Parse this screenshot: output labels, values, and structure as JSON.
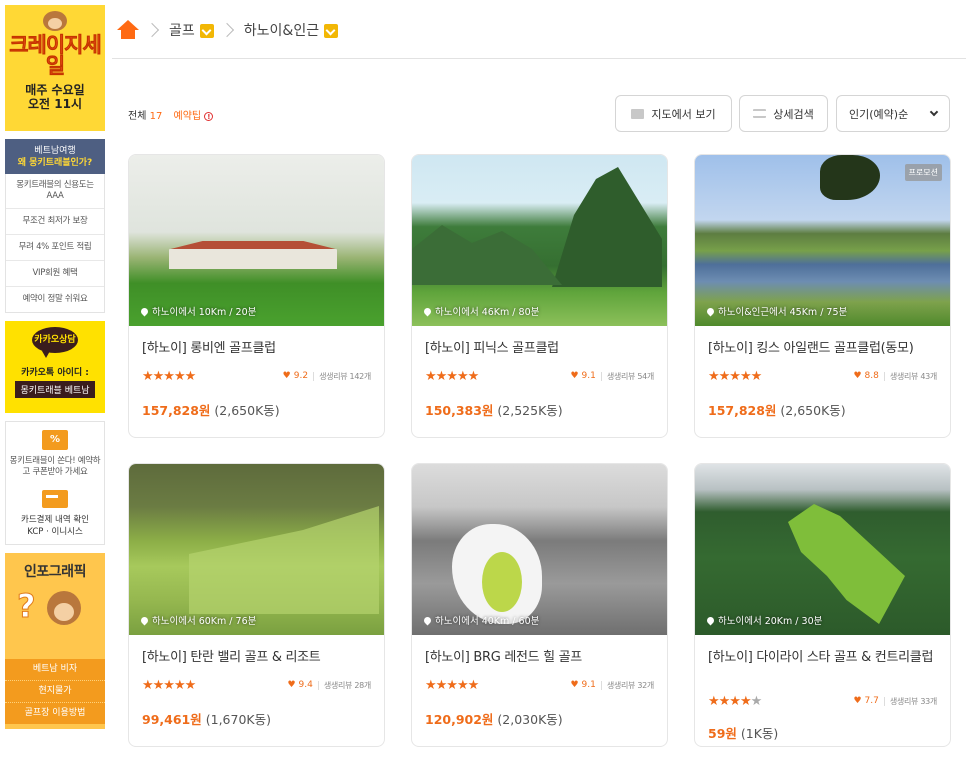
{
  "sidebar": {
    "crazy_title": "크레이지세일",
    "crazy_sub1": "매주 수요일",
    "crazy_sub2": "오전 11시",
    "why_line1": "베트남여행",
    "why_line2": "왜 몽키트래블인가?",
    "trust_items": [
      "몽키트래블의 신용도는 AAA",
      "무조건 최저가 보장",
      "무려 4% 포인트 적립",
      "VIP회원 혜택",
      "예약이 정말 쉬워요"
    ],
    "kakao_bubble": "카카오상담",
    "kakao_id_label": "카카오톡 아이디 :",
    "kakao_id": "몽키트래블 베트남",
    "coupon_icon": "%",
    "coupon_text": "몽키트래블이 쏜다! 예약하고 쿠폰받아 가세요",
    "card_text1": "카드결제 내역 확인",
    "card_text2": "KCP · 이니시스",
    "info_title": "인포그래픽",
    "info_links": [
      "베트남 비자",
      "현지물가",
      "골프장 이용방법"
    ]
  },
  "breadcrumb": {
    "cat1": "골프",
    "cat2": "하노이&인근"
  },
  "toolbar": {
    "total_label": "전체",
    "total_count": "17",
    "tip_label": "예약팁",
    "tip_icon": "!",
    "map_btn": "지도에서 보기",
    "filter_btn": "상세검색",
    "sort_btn": "인기(예약)순"
  },
  "colors": {
    "accent": "#ef6c1a",
    "home": "#ff6a13",
    "dropdown": "#f2b705"
  },
  "cards": [
    {
      "loc": "하노이에서 10Km / 20분",
      "name": "[하노이] 롱비엔 골프클럽",
      "stars": "★★★★★",
      "stars_off": "",
      "score": "9.2",
      "reviews": "생생리뷰 142개",
      "price_won": "157,828원",
      "price_local": "(2,650K동)",
      "promo": ""
    },
    {
      "loc": "하노이에서 46Km / 80분",
      "name": "[하노이] 피닉스 골프클럽",
      "stars": "★★★★★",
      "stars_off": "",
      "score": "9.1",
      "reviews": "생생리뷰 54개",
      "price_won": "150,383원",
      "price_local": "(2,525K동)",
      "promo": ""
    },
    {
      "loc": "하노이&인근에서 45Km / 75분",
      "name": "[하노이] 킹스 아일랜드 골프클럽(동모)",
      "stars": "★★★★★",
      "stars_off": "",
      "score": "8.8",
      "reviews": "생생리뷰 43개",
      "price_won": "157,828원",
      "price_local": "(2,650K동)",
      "promo": "프로모션"
    },
    {
      "loc": "하노이에서 60Km / 76분",
      "name": "[하노이] 탄란 밸리 골프 & 리조트",
      "stars": "★★★★★",
      "stars_off": "",
      "score": "9.4",
      "reviews": "생생리뷰 28개",
      "price_won": "99,461원",
      "price_local": "(1,670K동)",
      "promo": ""
    },
    {
      "loc": "하노이에서 40Km / 60분",
      "name": "[하노이] BRG 레전드 힐 골프",
      "stars": "★★★★★",
      "stars_off": "",
      "score": "9.1",
      "reviews": "생생리뷰 32개",
      "price_won": "120,902원",
      "price_local": "(2,030K동)",
      "promo": ""
    },
    {
      "loc": "하노이에서 20Km / 30분",
      "name": "[하노이] 다이라이 스타 골프 & 컨트리클럽",
      "stars": "★★★★",
      "stars_off": "★",
      "score": "7.7",
      "reviews": "생생리뷰 33개",
      "price_won": "59원",
      "price_local": "(1K동)",
      "promo": ""
    }
  ]
}
